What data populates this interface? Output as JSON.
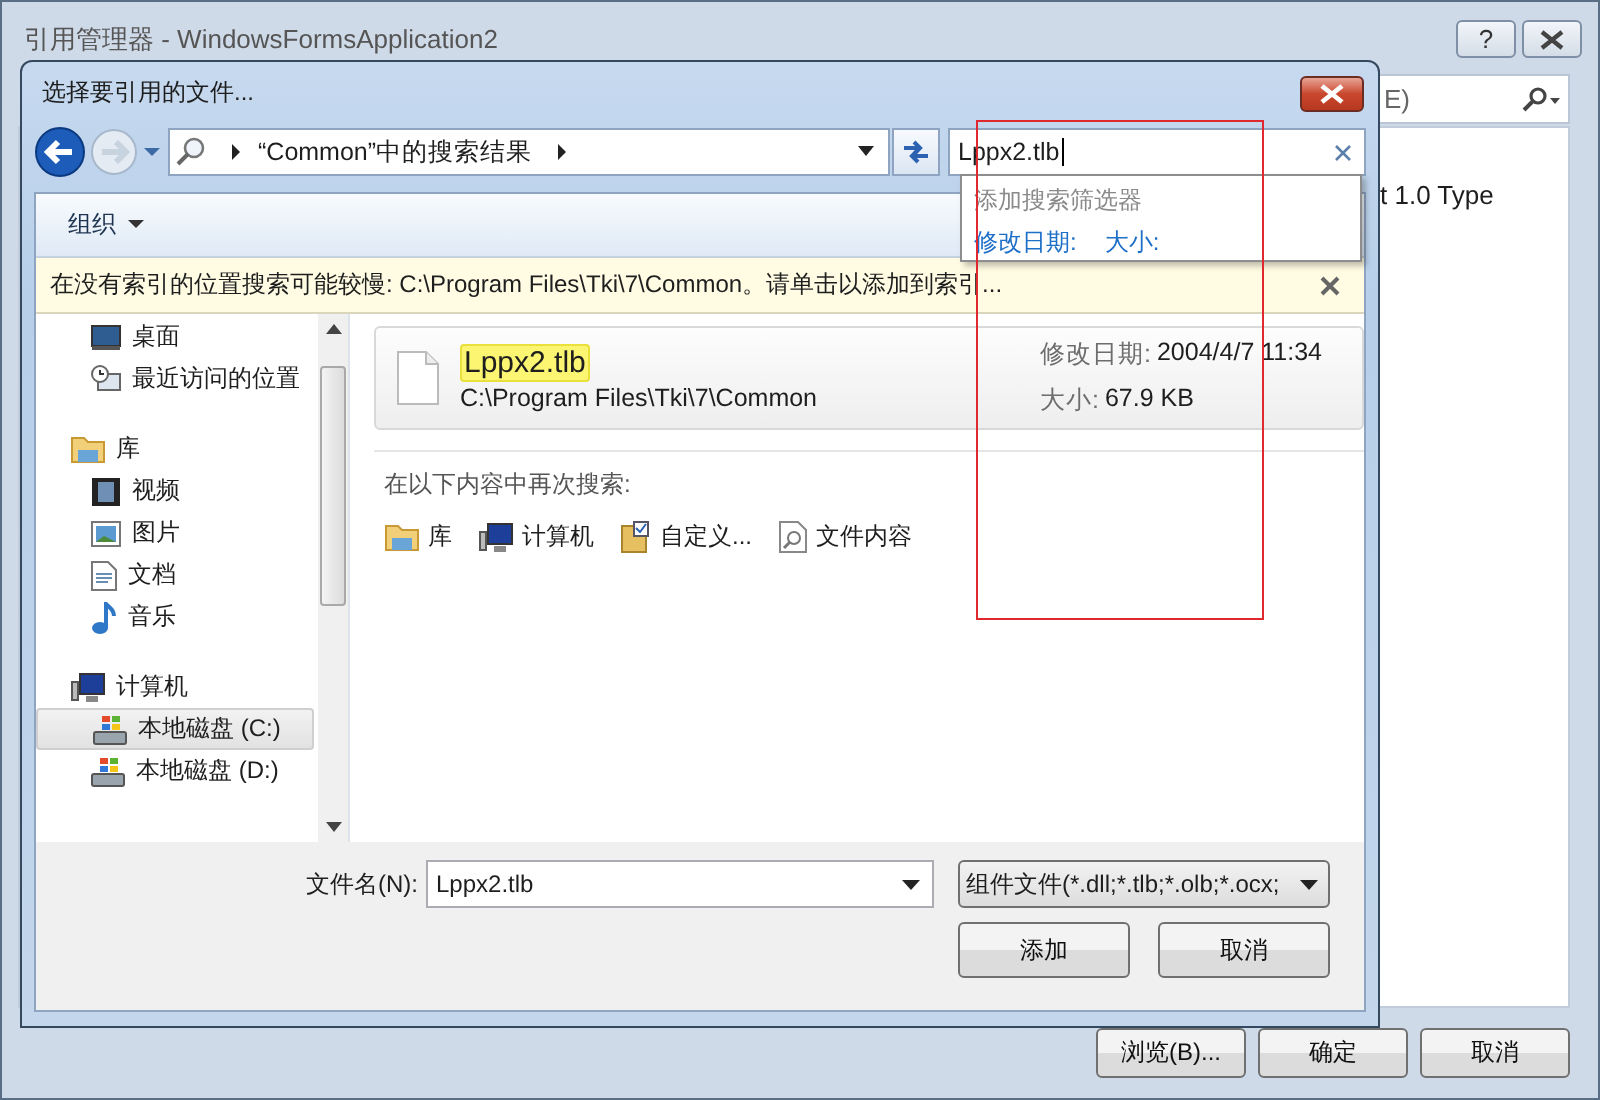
{
  "window": {
    "title": "引用管理器 - WindowsFormsApplication2",
    "help": "?"
  },
  "background_search": {
    "value": "E)"
  },
  "background_list": {
    "item": "t 1.0 Type"
  },
  "buttons": [
    "浏览(B)...",
    "确定",
    "取消"
  ],
  "dialog": {
    "title": "选择要引用的文件...",
    "address": {
      "segment": "“Common”中的搜索结果"
    },
    "search": {
      "value": "Lppx2.tlb"
    },
    "search_suggestions": {
      "heading": "添加搜索筛选器",
      "filters": [
        "修改日期:",
        "大小:"
      ]
    },
    "toolbar": {
      "organize": "组织"
    },
    "info_bar": "在没有索引的位置搜索可能较慢: C:\\Program Files\\Tki\\7\\Common。请单击以添加到索引...",
    "sidebar": {
      "items": [
        {
          "label": "桌面",
          "kind": "desktop",
          "selected": false
        },
        {
          "label": "最近访问的位置",
          "kind": "recent",
          "selected": false
        },
        {
          "label": "库",
          "kind": "library",
          "selected": false,
          "children": [
            {
              "label": "视频",
              "kind": "video",
              "selected": false
            },
            {
              "label": "图片",
              "kind": "picture",
              "selected": false
            },
            {
              "label": "文档",
              "kind": "document",
              "selected": false
            },
            {
              "label": "音乐",
              "kind": "music",
              "selected": false
            }
          ]
        },
        {
          "label": "计算机",
          "kind": "computer",
          "selected": false,
          "children": [
            {
              "label": "本地磁盘 (C:)",
              "kind": "drive",
              "selected": true
            },
            {
              "label": "本地磁盘 (D:)",
              "kind": "drive",
              "selected": false
            }
          ]
        }
      ]
    },
    "results": [
      {
        "name": "Lppx2.tlb",
        "path": "C:\\Program Files\\Tki\\7\\Common",
        "date_label": "修改日期:",
        "date": "2004/4/7 11:34",
        "size_label": "大小:",
        "size": "67.9 KB"
      }
    ],
    "search_again": {
      "heading": "在以下内容中再次搜索:",
      "places": [
        {
          "label": "库",
          "kind": "library"
        },
        {
          "label": "计算机",
          "kind": "computer"
        },
        {
          "label": "自定义...",
          "kind": "custom"
        },
        {
          "label": "文件内容",
          "kind": "contents"
        }
      ]
    },
    "file_name": {
      "label": "文件名(N):",
      "value": "Lppx2.tlb"
    },
    "file_type": {
      "value": "组件文件(*.dll;*.tlb;*.olb;*.ocx;"
    },
    "buttons": [
      "添加",
      "取消"
    ]
  }
}
